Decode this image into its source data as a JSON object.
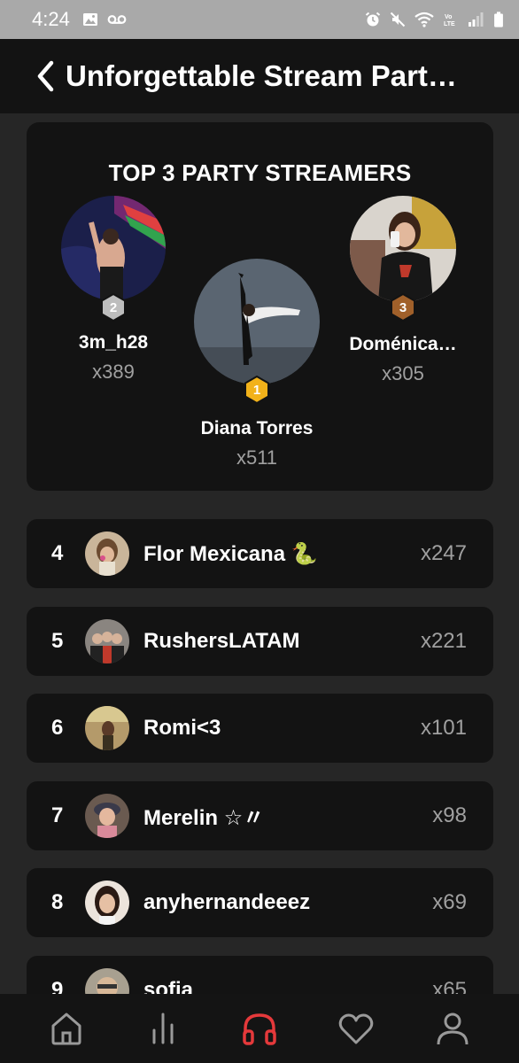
{
  "status_bar": {
    "time": "4:24",
    "left_icons": [
      "image-icon",
      "voicemail-icon"
    ],
    "right_icons": [
      "alarm-icon",
      "mute-icon",
      "wifi-icon",
      "volte-icon",
      "signal-icon",
      "battery-icon"
    ]
  },
  "header": {
    "title": "Unforgettable Stream Part…"
  },
  "top3": {
    "title": "TOP 3 PARTY STREAMERS",
    "podium": [
      {
        "rank": "2",
        "name": "3m_h28",
        "count": "x389",
        "badge_color": "#bdbdbd"
      },
      {
        "rank": "1",
        "name": "Diana Torres",
        "count": "x511",
        "badge_color": "#f2b21a"
      },
      {
        "rank": "3",
        "name": "Doménica…",
        "count": "x305",
        "badge_color": "#a0602a"
      }
    ]
  },
  "rankings": [
    {
      "rank": "4",
      "name": "Flor Mexicana 🐍",
      "count": "x247"
    },
    {
      "rank": "5",
      "name": "RushersLATAM",
      "count": "x221"
    },
    {
      "rank": "6",
      "name": "Romi<3",
      "count": "x101"
    },
    {
      "rank": "7",
      "name": "Merelin ☆〃",
      "count": "x98"
    },
    {
      "rank": "8",
      "name": "anyhernandeeez",
      "count": "x69"
    },
    {
      "rank": "9",
      "name": "sofia",
      "count": "x65"
    }
  ],
  "bottom_nav": {
    "items": [
      "home-icon",
      "stats-icon",
      "headphones-icon",
      "heart-icon",
      "profile-icon"
    ],
    "active": "headphones-icon",
    "active_color": "#e5393b"
  }
}
